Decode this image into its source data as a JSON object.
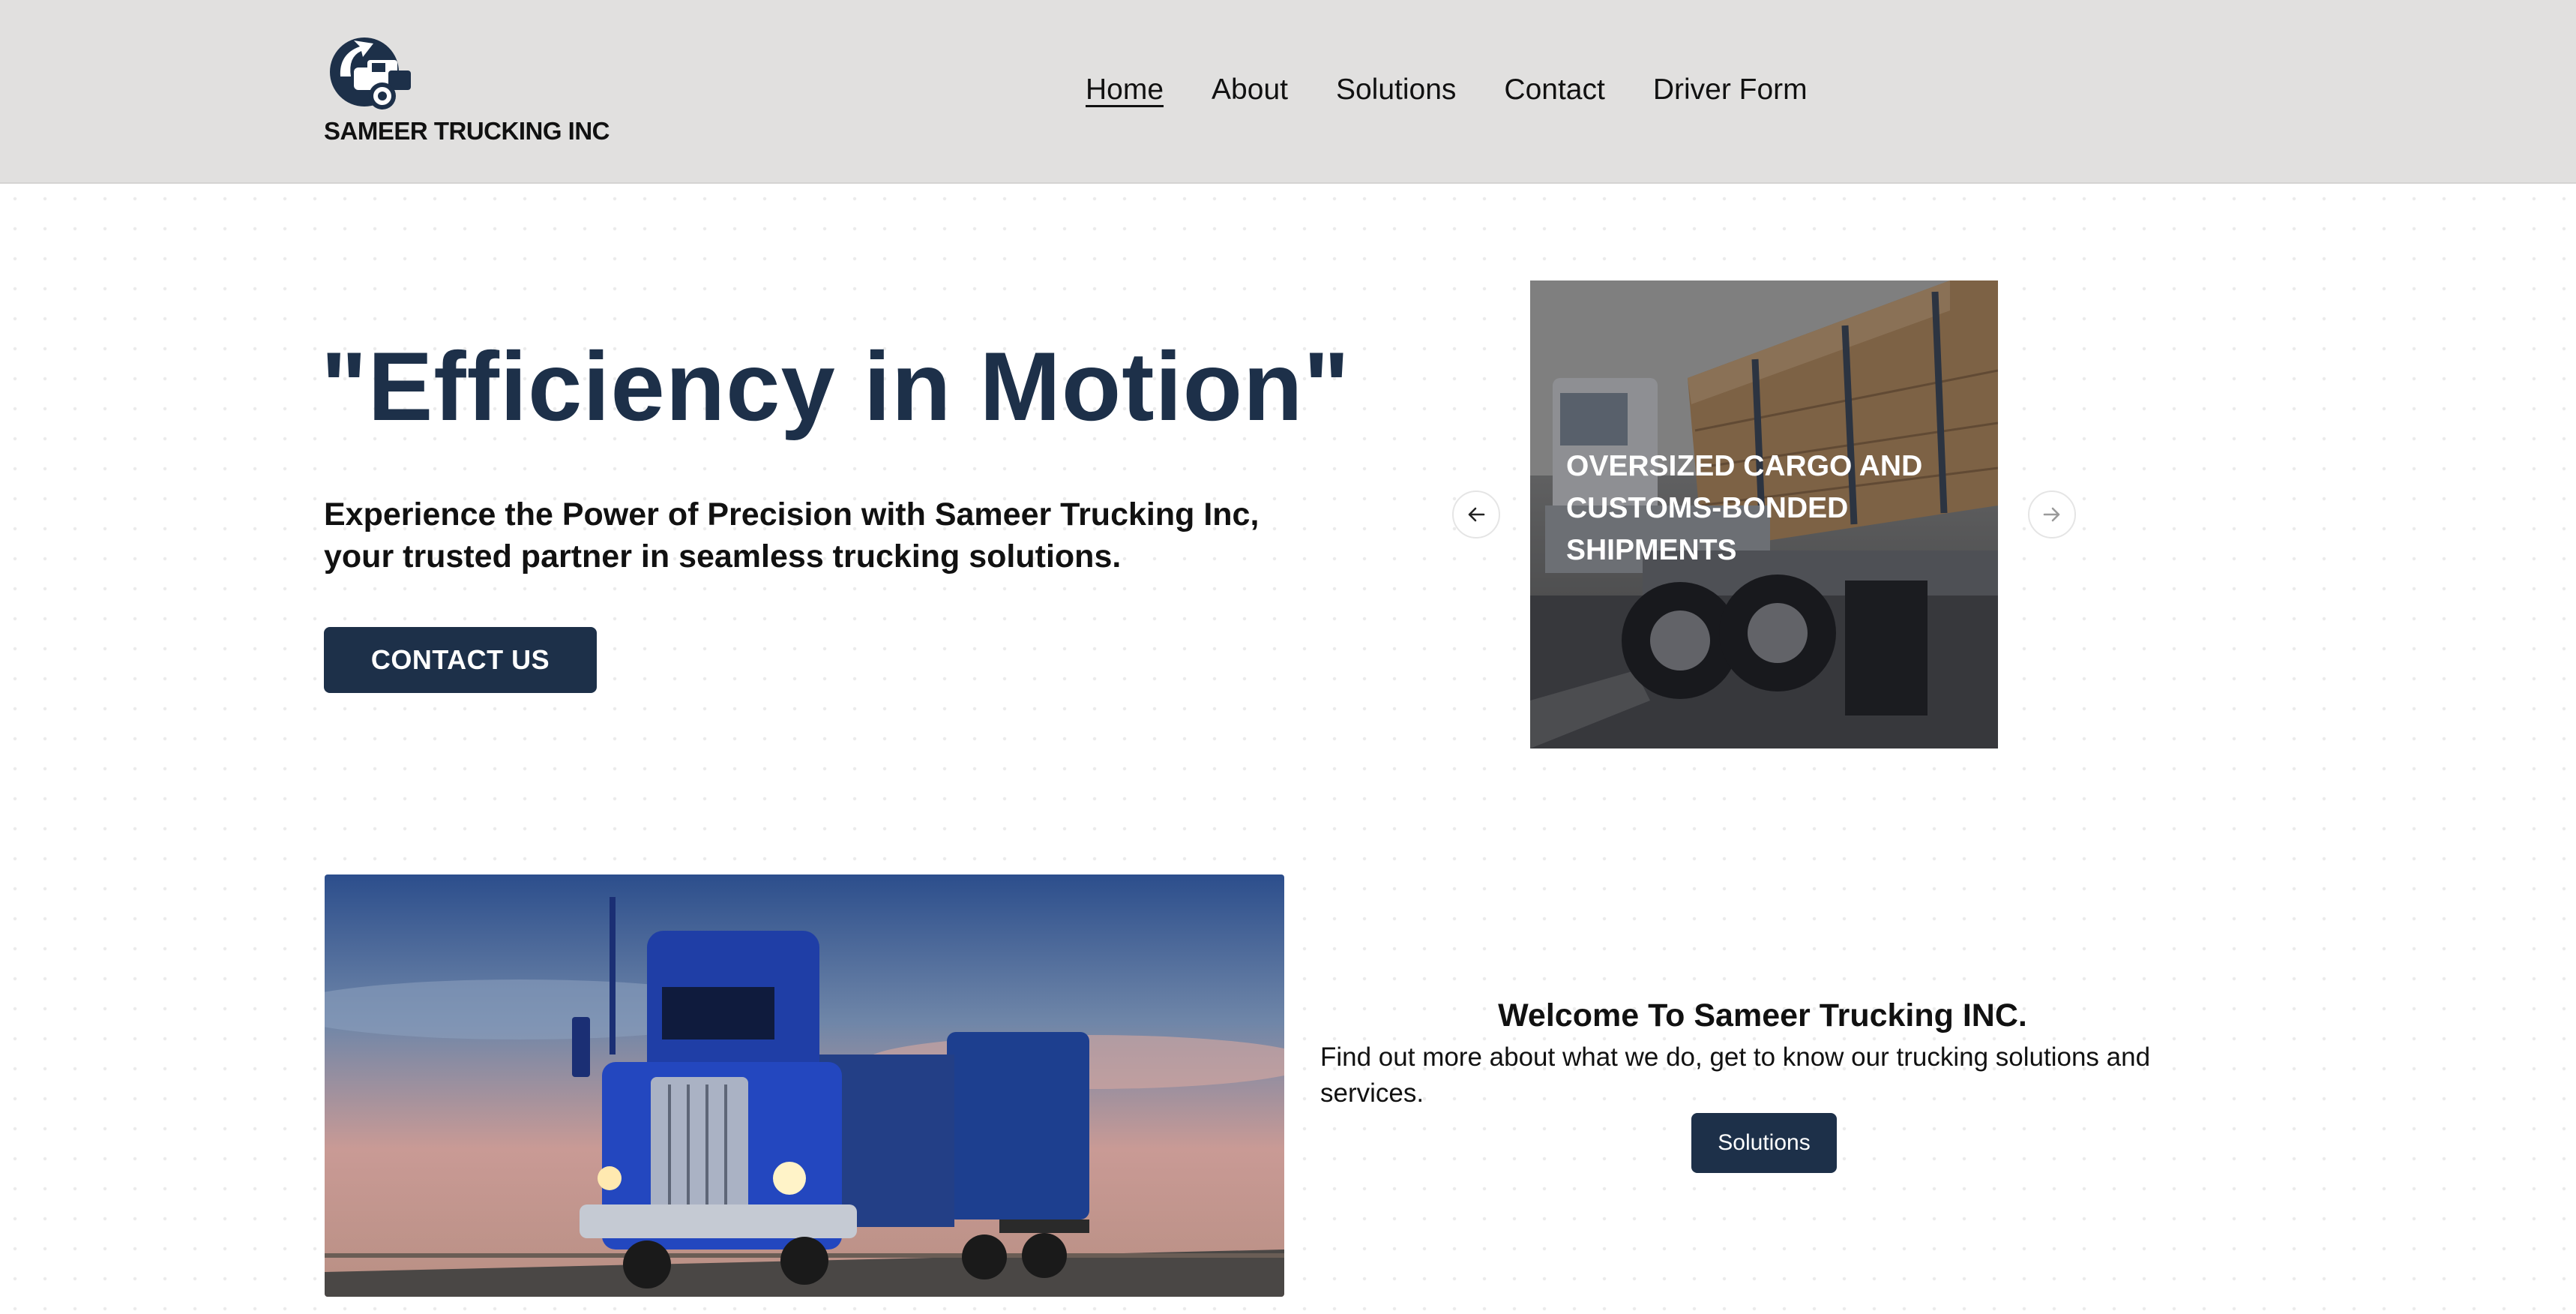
{
  "brand": {
    "name": "SAMEER TRUCKING INC",
    "logo_icon": "truck-cab-logo-icon",
    "primary_color": "#1d3049",
    "header_bg": "#e1e0df"
  },
  "nav": {
    "items": [
      {
        "label": "Home",
        "active": true
      },
      {
        "label": "About",
        "active": false
      },
      {
        "label": "Solutions",
        "active": false
      },
      {
        "label": "Contact",
        "active": false
      },
      {
        "label": "Driver Form",
        "active": false
      }
    ]
  },
  "hero": {
    "title": "\"Efficiency in Motion\"",
    "subtitle": "Experience the Power of Precision with Sameer Trucking Inc, your trusted partner in seamless trucking solutions.",
    "cta_label": "CONTACT US"
  },
  "carousel": {
    "caption": "OVERSIZED CARGO AND CUSTOMS-BONDED SHIPMENTS",
    "prev_icon": "arrow-left-icon",
    "next_icon": "arrow-right-icon"
  },
  "welcome": {
    "title": "Welcome To Sameer Trucking INC.",
    "text": "Find out more about what we do, get to know our trucking solutions and services.",
    "button_label": "Solutions"
  }
}
